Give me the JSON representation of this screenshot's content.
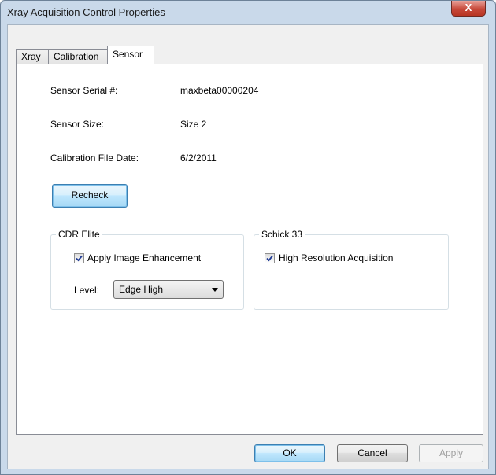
{
  "window": {
    "title": "Xray Acquisition Control Properties",
    "close_glyph": "X"
  },
  "tabs": [
    {
      "label": "Xray",
      "active": false
    },
    {
      "label": "Calibration",
      "active": false
    },
    {
      "label": "Sensor",
      "active": true
    }
  ],
  "sensor": {
    "serial_label": "Sensor Serial #:",
    "serial_value": "maxbeta00000204",
    "size_label": "Sensor Size:",
    "size_value": "Size 2",
    "cal_date_label": "Calibration File Date:",
    "cal_date_value": "6/2/2011",
    "recheck_label": "Recheck"
  },
  "cdr_elite": {
    "title": "CDR Elite",
    "enhance_label": "Apply Image Enhancement",
    "enhance_checked": true,
    "level_label": "Level:",
    "level_value": "Edge High"
  },
  "schick33": {
    "title": "Schick 33",
    "hires_label": "High Resolution Acquisition",
    "hires_checked": true
  },
  "buttons": {
    "ok": "OK",
    "cancel": "Cancel",
    "apply": "Apply"
  },
  "colors": {
    "frame": "#c9d9ea",
    "close": "#c7493a",
    "focus_button": "#bee6fd"
  }
}
